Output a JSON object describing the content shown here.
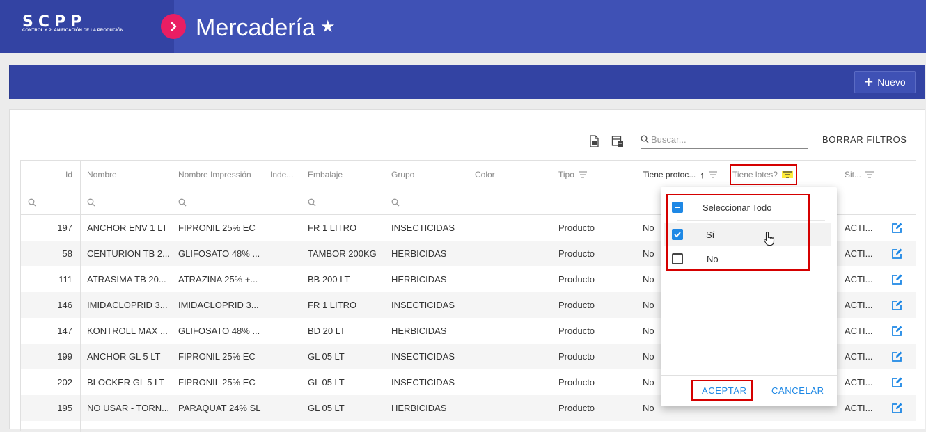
{
  "header": {
    "logo_letters": "SCPP",
    "logo_subtitle": "CONTROL Y PLANIFICACIÓN DE LA PRODUCIÓN",
    "title": "Mercadería"
  },
  "toolbar": {
    "new_label": "Nuevo"
  },
  "panel": {
    "search_placeholder": "Buscar...",
    "clear_filters": "BORRAR FILTROS"
  },
  "columns": [
    "Id",
    "Nombre",
    "Nombre Impressión",
    "Inde...",
    "Embalaje",
    "Grupo",
    "Color",
    "Tipo",
    "Tiene protoc...",
    "Tiene lotes?",
    "Sit..."
  ],
  "rows": [
    {
      "id": "197",
      "nombre": "ANCHOR ENV 1 LT",
      "impresion": "FIPRONIL 25% EC",
      "embalaje": "FR 1 LITRO",
      "grupo": "INSECTICIDAS",
      "tipo": "Producto",
      "protoc": "No",
      "sit": "ACTI..."
    },
    {
      "id": "58",
      "nombre": "CENTURION TB 2...",
      "impresion": "GLIFOSATO 48% ...",
      "embalaje": "TAMBOR 200KG",
      "grupo": "HERBICIDAS",
      "tipo": "Producto",
      "protoc": "No",
      "sit": "ACTI..."
    },
    {
      "id": "111",
      "nombre": "ATRASIMA TB 20...",
      "impresion": "ATRAZINA 25% +...",
      "embalaje": "BB 200 LT",
      "grupo": "HERBICIDAS",
      "tipo": "Producto",
      "protoc": "No",
      "sit": "ACTI..."
    },
    {
      "id": "146",
      "nombre": "IMIDACLOPRID 3...",
      "impresion": "IMIDACLOPRID 3...",
      "embalaje": "FR 1 LITRO",
      "grupo": "INSECTICIDAS",
      "tipo": "Producto",
      "protoc": "No",
      "sit": "ACTI..."
    },
    {
      "id": "147",
      "nombre": "KONTROLL MAX ...",
      "impresion": "GLIFOSATO 48% ...",
      "embalaje": "BD 20 LT",
      "grupo": "HERBICIDAS",
      "tipo": "Producto",
      "protoc": "No",
      "sit": "ACTI..."
    },
    {
      "id": "199",
      "nombre": "ANCHOR GL 5 LT",
      "impresion": "FIPRONIL 25% EC",
      "embalaje": "GL 05 LT",
      "grupo": "INSECTICIDAS",
      "tipo": "Producto",
      "protoc": "No",
      "sit": "ACTI..."
    },
    {
      "id": "202",
      "nombre": "BLOCKER GL 5 LT",
      "impresion": "FIPRONIL 25% EC",
      "embalaje": "GL 05 LT",
      "grupo": "INSECTICIDAS",
      "tipo": "Producto",
      "protoc": "No",
      "sit": "ACTI..."
    },
    {
      "id": "195",
      "nombre": "NO USAR - TORN...",
      "impresion": "PARAQUAT 24% SL",
      "embalaje": "GL 05 LT",
      "grupo": "HERBICIDAS",
      "tipo": "Producto",
      "protoc": "No",
      "sit": "ACTI..."
    }
  ],
  "filter_popup": {
    "select_all": "Seleccionar Todo",
    "options": [
      {
        "label": "Sí",
        "checked": true
      },
      {
        "label": "No",
        "checked": false
      }
    ],
    "accept": "ACEPTAR",
    "cancel": "CANCELAR"
  },
  "colors": {
    "header_bg": "#3f51b5",
    "accent_pink": "#e91e63",
    "link_blue": "#1e88e5",
    "highlight_red": "#d50000",
    "filter_yellow": "#ffeb3b"
  }
}
